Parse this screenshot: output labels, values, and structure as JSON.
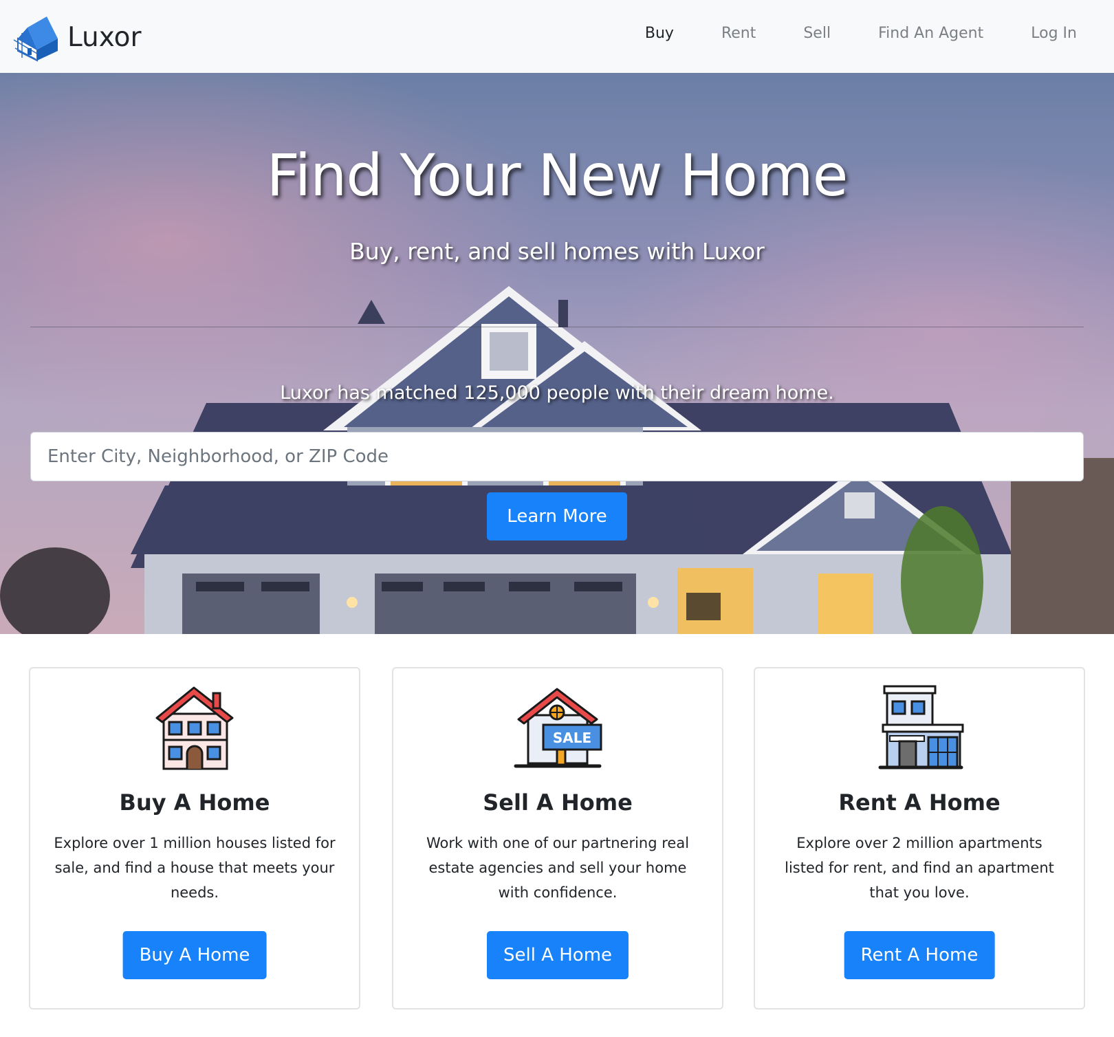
{
  "brand": {
    "name": "Luxor",
    "logo_icon": "house-cube-logo-icon"
  },
  "nav": {
    "items": [
      {
        "label": "Buy",
        "active": true
      },
      {
        "label": "Rent",
        "active": false
      },
      {
        "label": "Sell",
        "active": false
      },
      {
        "label": "Find An Agent",
        "active": false
      },
      {
        "label": "Log In",
        "active": false
      }
    ]
  },
  "hero": {
    "title": "Find Your New Home",
    "subtitle": "Buy, rent, and sell homes with Luxor",
    "tagline": "Luxor has matched 125,000 people with their dream home.",
    "search_placeholder": "Enter City, Neighborhood, or ZIP Code",
    "search_value": "",
    "button_label": "Learn More"
  },
  "cards": [
    {
      "icon": "house-icon",
      "title": "Buy A Home",
      "text": "Explore over 1 million houses listed for sale, and find a house that meets your needs.",
      "button": "Buy A Home"
    },
    {
      "icon": "sale-sign-house-icon",
      "title": "Sell A Home",
      "text": "Work with one of our partnering real estate agencies and sell your home with confidence.",
      "button": "Sell A Home"
    },
    {
      "icon": "apartment-building-icon",
      "title": "Rent A Home",
      "text": "Explore over 2 million apartments listed for rent, and find an apartment that you love.",
      "button": "Rent A Home"
    }
  ],
  "colors": {
    "primary": "#1782fa",
    "navbar_bg": "#f8f9fa",
    "nav_muted": "#7b7f83"
  }
}
